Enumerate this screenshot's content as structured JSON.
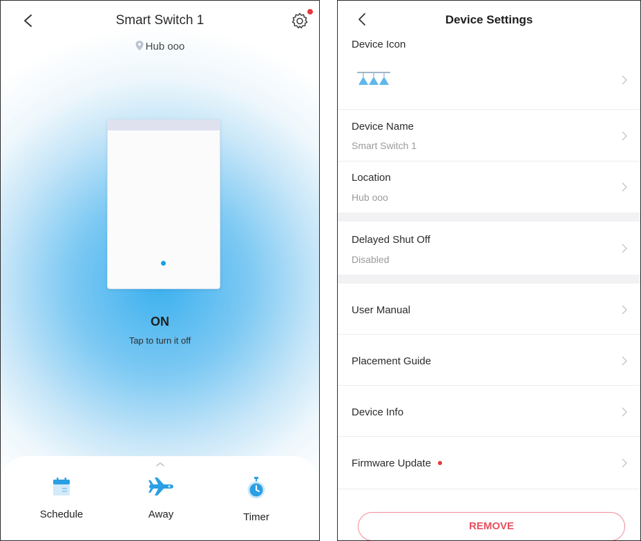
{
  "switch_screen": {
    "title": "Smart Switch 1",
    "location": "Hub ooo",
    "state": "ON",
    "hint": "Tap to turn it off",
    "dock": [
      {
        "label": "Schedule",
        "icon": "calendar-icon"
      },
      {
        "label": "Away",
        "icon": "airplane-icon"
      },
      {
        "label": "Timer",
        "icon": "timer-icon"
      }
    ],
    "accent_color": "#1a9fe6",
    "glow_color": "#3bb0ee"
  },
  "settings_screen": {
    "title": "Device Settings",
    "device_icon_label": "Device Icon",
    "device_icon": "ceiling-lights-icon",
    "device_name_label": "Device Name",
    "device_name_value": "Smart Switch 1",
    "location_label": "Location",
    "location_value": "Hub ooo",
    "delayed_label": "Delayed Shut Off",
    "delayed_value": "Disabled",
    "user_manual_label": "User Manual",
    "placement_label": "Placement Guide",
    "device_info_label": "Device Info",
    "firmware_label": "Firmware Update",
    "remove_label": "REMOVE",
    "remove_color": "#e8505f",
    "badge_color": "#e8383d"
  }
}
